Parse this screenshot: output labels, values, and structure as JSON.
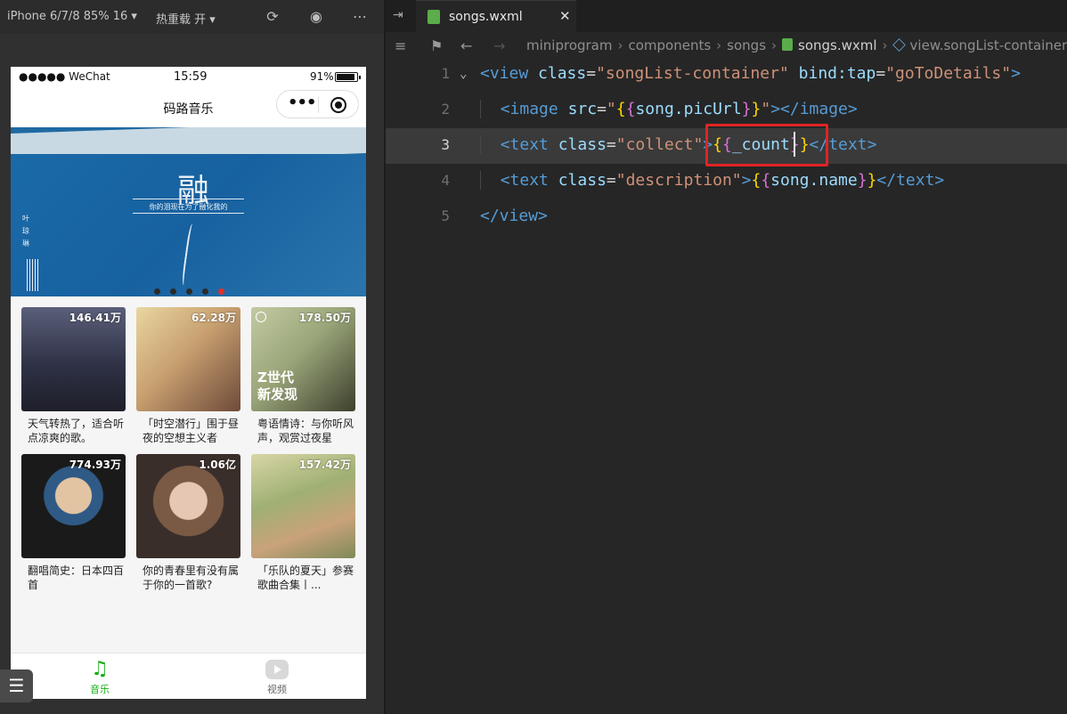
{
  "simulator": {
    "device": "iPhone 6/7/8 85% 16 ▾",
    "hot_reload": "热重载 开 ▾",
    "icons": [
      "refresh-icon",
      "stop-icon",
      "more-icon"
    ]
  },
  "phone": {
    "carrier": "●●●●● WeChat",
    "time": "15:59",
    "battery": "91%",
    "nav_title": "码路音乐",
    "capsule_dots": "•••",
    "banner": {
      "calligraphy": "融",
      "subtitle": "你的泪现在为了融化我的",
      "side_text": "叶琼琳",
      "dot_count": 5,
      "active_dot": 4
    },
    "playlists": [
      {
        "count": "146.41万",
        "desc": "天气转热了，适合听点凉爽的歌。",
        "color": "#3a3e52"
      },
      {
        "count": "62.28万",
        "desc": "「时空潜行」围于昼夜的空想主义者",
        "color": "#c4a47a"
      },
      {
        "count": "178.50万",
        "desc": "粤语情诗：与你听风声，观赏过夜星",
        "color": "#8e9a6e",
        "overlay": "Z世代\n新发现"
      },
      {
        "count": "774.93万",
        "desc": "翻唱简史：日本四百首",
        "color": "#2c3a4a"
      },
      {
        "count": "1.06亿",
        "desc": "你的青春里有没有属于你的一首歌?",
        "color": "#6b5a52"
      },
      {
        "count": "157.42万",
        "desc": "「乐队的夏天」参赛歌曲合集丨...",
        "color": "#a9a678"
      }
    ],
    "tabs": [
      {
        "label": "音乐",
        "icon": "music-note-icon",
        "active": true
      },
      {
        "label": "视频",
        "icon": "video-play-icon",
        "active": false
      }
    ]
  },
  "editor": {
    "file_tab": "songs.wxml",
    "close_glyph": "✕",
    "breadcrumbs": [
      "miniprogram",
      "components",
      "songs",
      "songs.wxml",
      "view.songList-container"
    ],
    "line_numbers": [
      "1",
      "2",
      "3",
      "4",
      "5"
    ],
    "current_line": 3,
    "code": {
      "l1_open": "<view",
      "l1_attr1": "class",
      "l1_val1": "\"songList-container\"",
      "l1_attr2": "bind:tap",
      "l1_val2": "\"goToDetails\"",
      "l1_close": ">",
      "l2_open": "<image",
      "l2_attr": "src",
      "l2_q1": "\"",
      "l2_var": "song.picUrl",
      "l2_q2": "\"",
      "l2_close": "></image>",
      "l3_open": "<text",
      "l3_attr": "class",
      "l3_val": "\"collect\"",
      "l3_gt": ">",
      "l3_var": "_count",
      "l3_close": "</text>",
      "l4_open": "<text",
      "l4_attr": "class",
      "l4_val": "\"description\"",
      "l4_gt": ">",
      "l4_var": "song.name",
      "l4_close": "</text>",
      "l5": "</view>"
    }
  }
}
